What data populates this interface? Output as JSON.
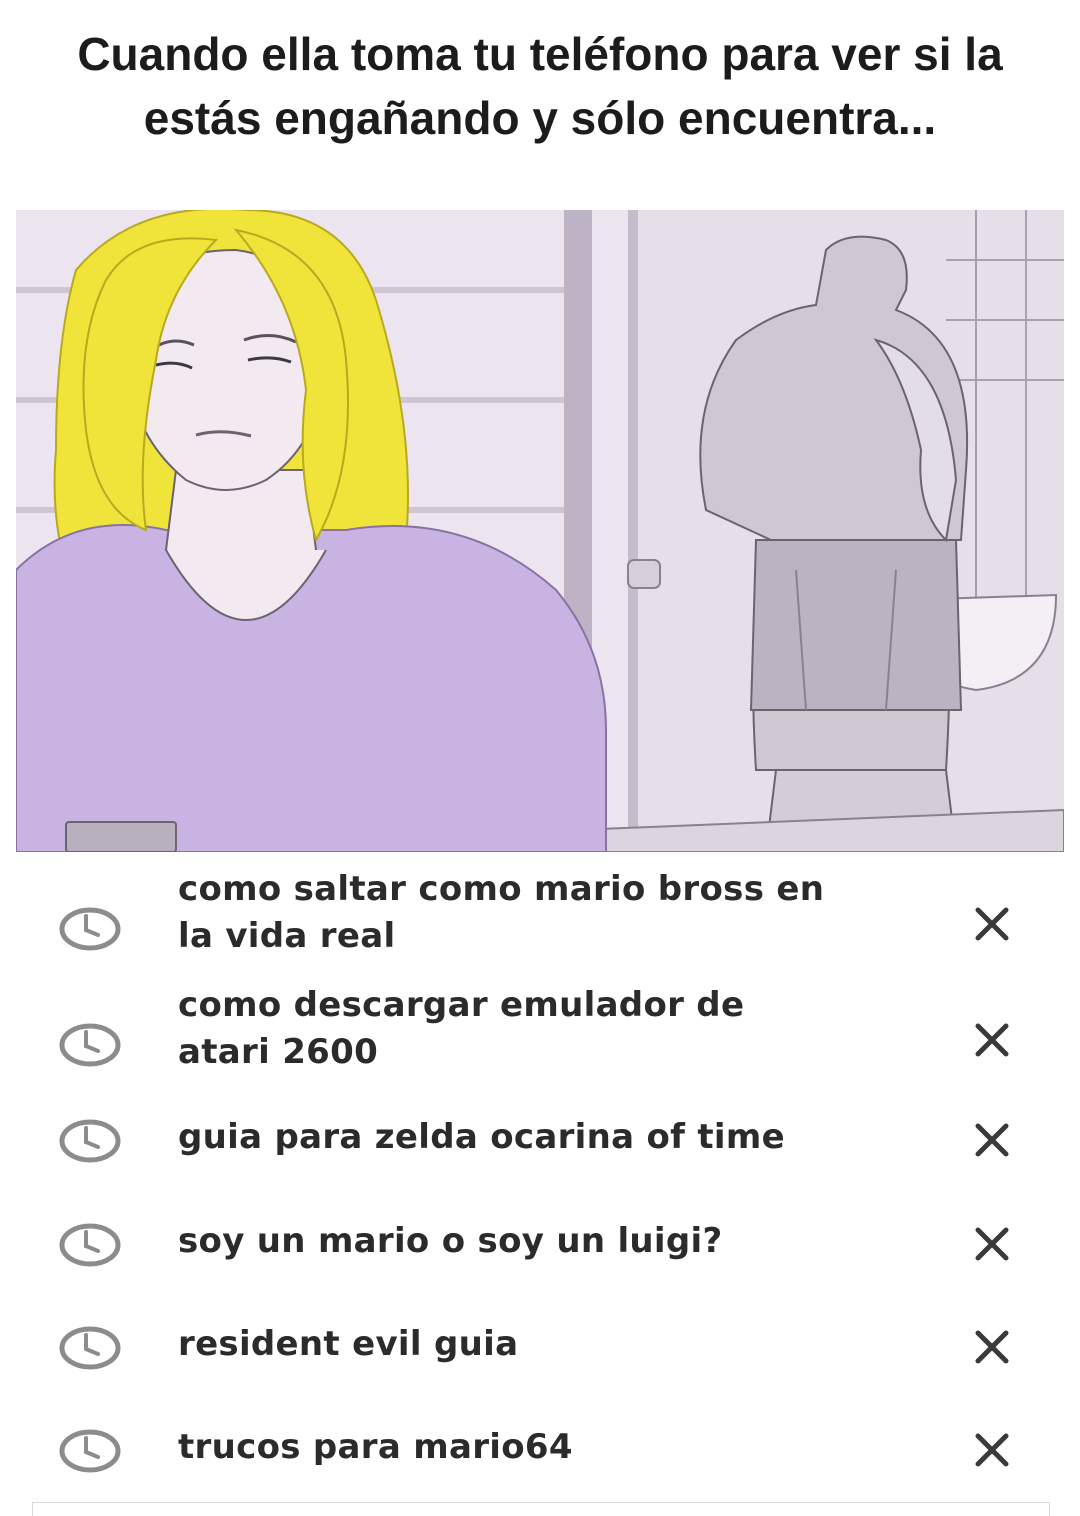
{
  "caption": {
    "line1": "Cuando ella toma tu teléfono para ver si la",
    "line2": "estás engañando y sólo encuentra..."
  },
  "illustration": {
    "colors": {
      "background": "#ece4ef",
      "hair": "#f0e43a",
      "shirt": "#c9b3e2",
      "skin": "#f2eaf0",
      "lines": "#6b6370"
    }
  },
  "search_history": {
    "icon": "clock-icon",
    "remove_icon": "close-icon",
    "items": [
      {
        "line1": "como saltar como mario bross en",
        "line2": "la vida real"
      },
      {
        "line1": "como descargar emulador de",
        "line2": "atari 2600"
      },
      {
        "line1": "guia para zelda ocarina of time",
        "line2": ""
      },
      {
        "line1": "soy un mario o soy un luigi?",
        "line2": ""
      },
      {
        "line1": "resident evil guia",
        "line2": ""
      },
      {
        "line1": "trucos para mario64",
        "line2": ""
      }
    ]
  }
}
